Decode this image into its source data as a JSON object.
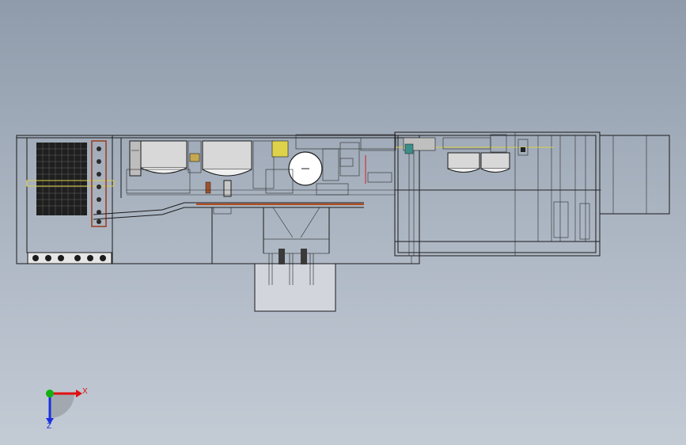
{
  "viewport": {
    "background_top": "#8f9bab",
    "background_bottom": "#c3cbd5"
  },
  "triad": {
    "x_label": "X",
    "z_label": "Z",
    "x_color": "#e01010",
    "y_color": "#12b012",
    "z_color": "#1a2ee0"
  },
  "drawing": {
    "view": "front",
    "line_color": "#1b1b1b"
  }
}
